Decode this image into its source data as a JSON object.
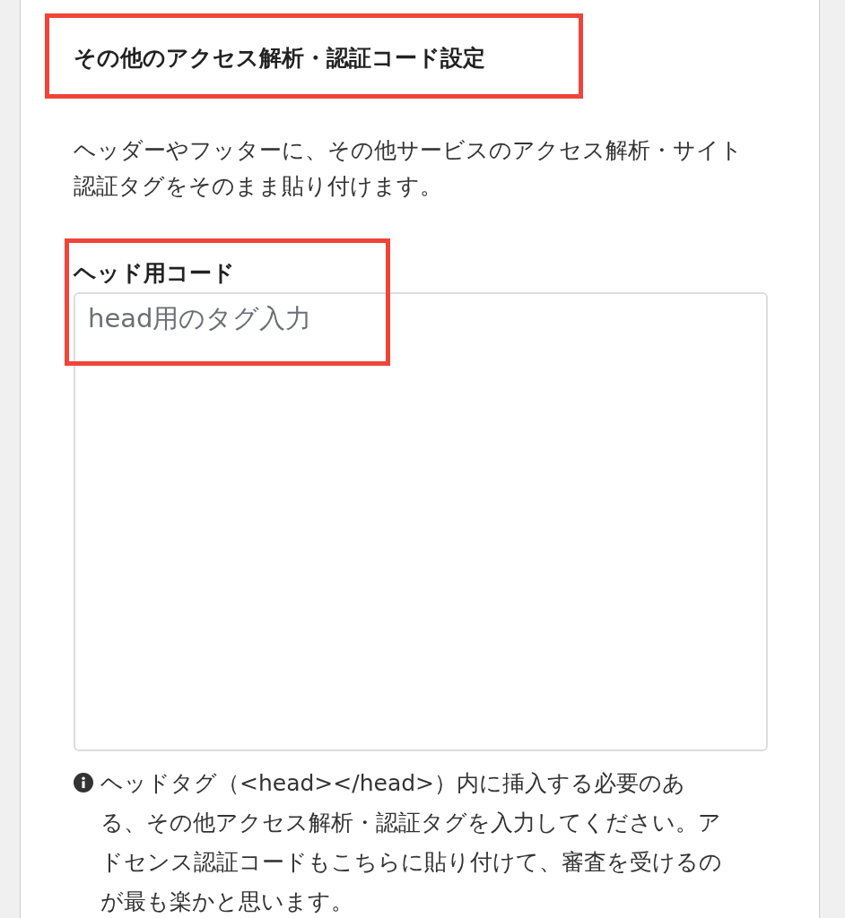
{
  "section": {
    "title": "その他のアクセス解析・認証コード設定",
    "highlighted": true,
    "description": [
      "ヘッダーやフッターに、その他サービスのアクセス解析・サイト",
      "認証タグをそのまま貼り付けます。"
    ]
  },
  "head_code": {
    "label": "ヘッド用コード",
    "placeholder": "head用のタグ入力",
    "highlighted": true,
    "note": [
      "ヘッドタグ（<head></head>）内に挿入する必要のあ",
      "る、その他アクセス解析・認証タグを入力してください。ア",
      "ドセンス認証コードもこちらに貼り付けて、審査を受けるの",
      "が最も楽かと思います。"
    ]
  }
}
